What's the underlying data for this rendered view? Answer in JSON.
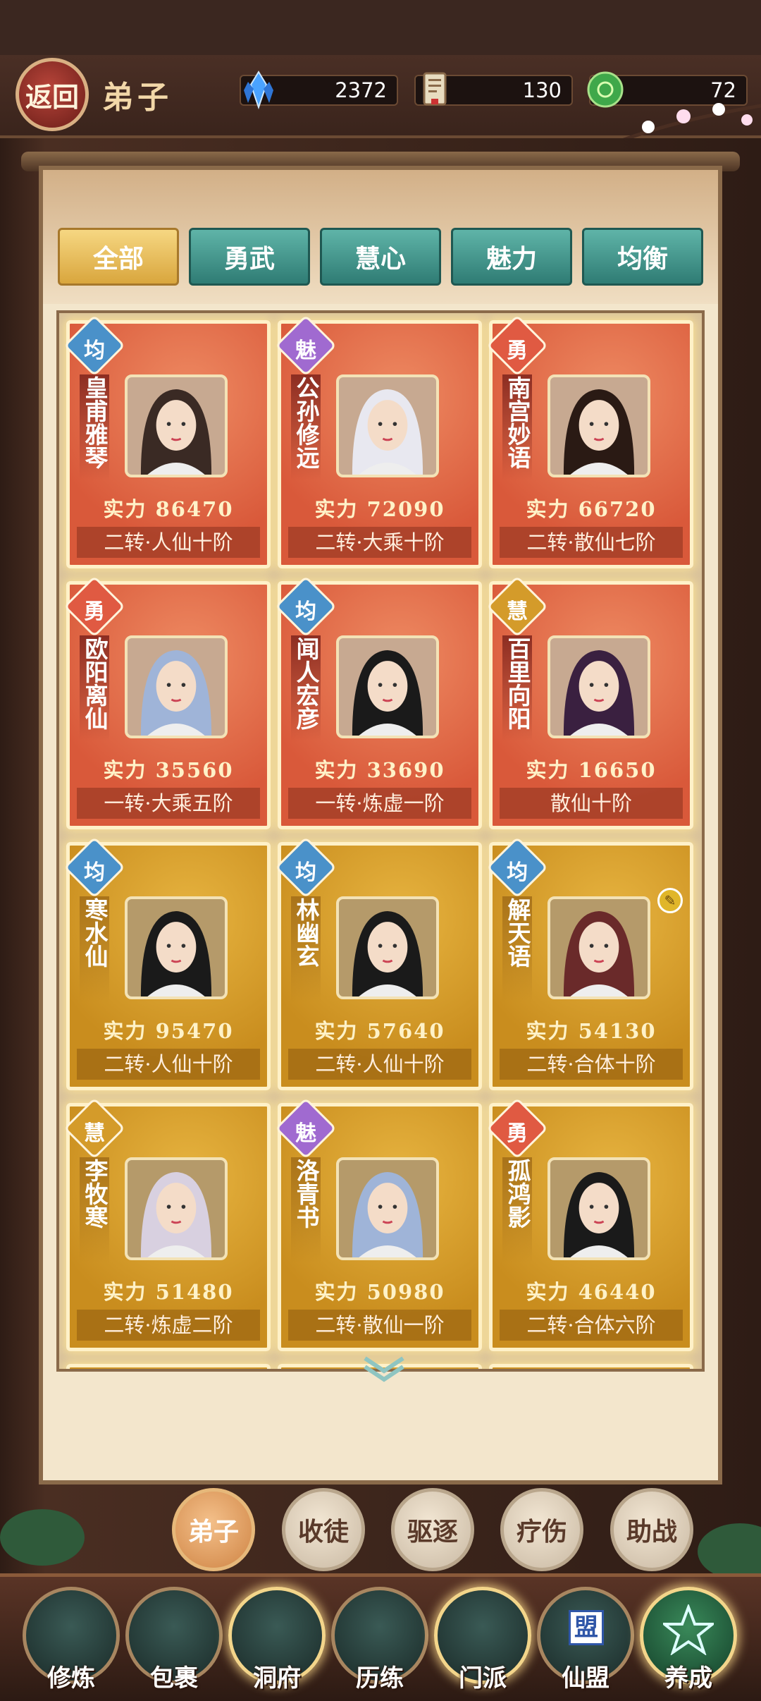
{
  "header": {
    "back_label": "返回",
    "title": "弟子",
    "resources": [
      {
        "icon": "crystal-icon",
        "value": "2372"
      },
      {
        "icon": "scroll-token-icon",
        "value": "130"
      },
      {
        "icon": "jade-coin-icon",
        "value": "72"
      }
    ]
  },
  "tabs": [
    "全部",
    "勇武",
    "慧心",
    "魅力",
    "均衡"
  ],
  "power_label": "实力",
  "disciples": [
    {
      "name": "皇甫雅琴",
      "attr": "均",
      "power": "86470",
      "rank": "二转·人仙十阶"
    },
    {
      "name": "公孙修远",
      "attr": "魅",
      "power": "72090",
      "rank": "二转·大乘十阶"
    },
    {
      "name": "南宫妙语",
      "attr": "勇",
      "power": "66720",
      "rank": "二转·散仙七阶"
    },
    {
      "name": "欧阳离仙",
      "attr": "勇",
      "power": "35560",
      "rank": "一转·大乘五阶"
    },
    {
      "name": "闻人宏彦",
      "attr": "均",
      "power": "33690",
      "rank": "一转·炼虚一阶"
    },
    {
      "name": "百里向阳",
      "attr": "慧",
      "power": "16650",
      "rank": "散仙十阶"
    },
    {
      "name": "寒水仙",
      "attr": "均",
      "power": "95470",
      "rank": "二转·人仙十阶"
    },
    {
      "name": "林幽玄",
      "attr": "均",
      "power": "57640",
      "rank": "二转·人仙十阶"
    },
    {
      "name": "解天语",
      "attr": "均",
      "power": "54130",
      "rank": "二转·合体十阶"
    },
    {
      "name": "李牧寒",
      "attr": "慧",
      "power": "51480",
      "rank": "二转·炼虚二阶"
    },
    {
      "name": "洛青书",
      "attr": "魅",
      "power": "50980",
      "rank": "二转·散仙一阶"
    },
    {
      "name": "孤鸿影",
      "attr": "勇",
      "power": "46440",
      "rank": "二转·合体六阶"
    }
  ],
  "sub_actions": [
    "弟子",
    "收徒",
    "驱逐",
    "疗伤",
    "助战"
  ],
  "bottom_nav": [
    "修炼",
    "包裹",
    "洞府",
    "历练",
    "门派",
    "仙盟",
    "养成"
  ],
  "nav_inner_text": {
    "alliance": "盟"
  }
}
